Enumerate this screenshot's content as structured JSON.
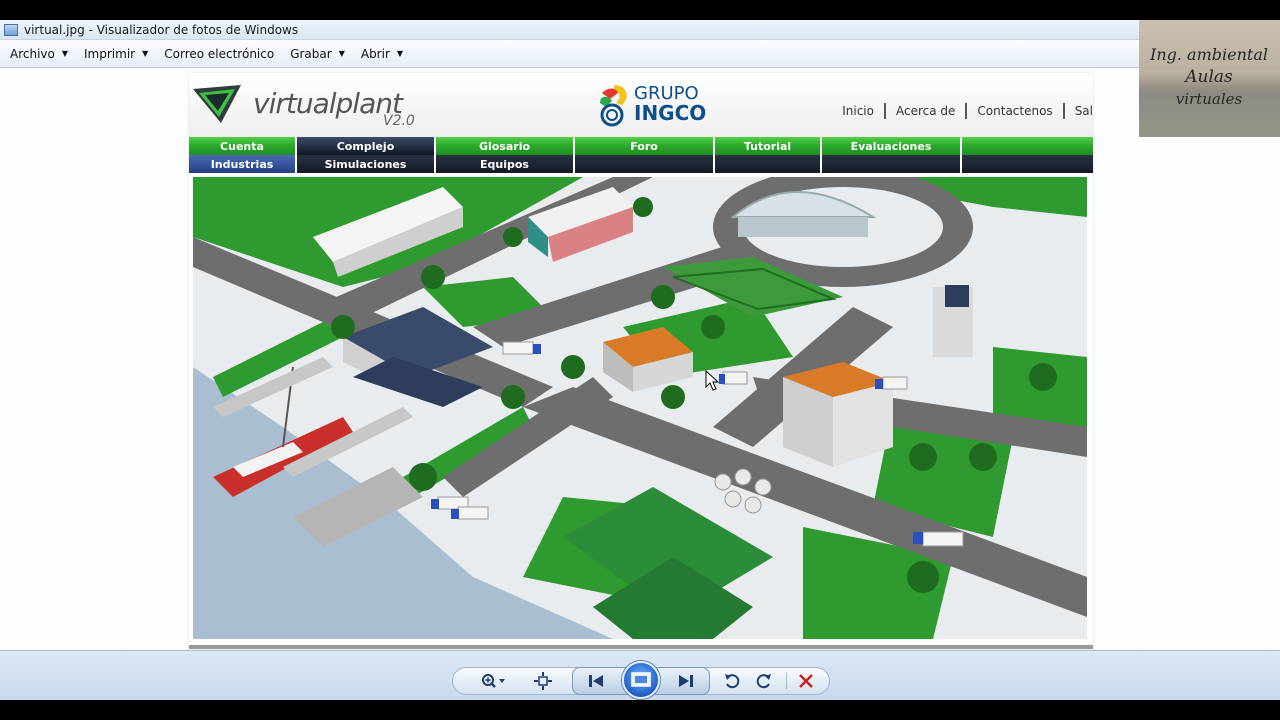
{
  "window": {
    "title": "virtual.jpg - Visualizador de fotos de Windows"
  },
  "menu": [
    {
      "label": "Archivo",
      "has_caret": true
    },
    {
      "label": "Imprimir",
      "has_caret": true
    },
    {
      "label": "Correo electrónico",
      "has_caret": false
    },
    {
      "label": "Grabar",
      "has_caret": true
    },
    {
      "label": "Abrir",
      "has_caret": true
    }
  ],
  "site": {
    "logo_left": {
      "wordmark": "virtualplant",
      "version": "V2.0"
    },
    "logo_center": {
      "grupo": "GRUPO",
      "ingco": "INGCO"
    },
    "top_links": [
      "Inicio",
      "Acerca de",
      "Contactenos",
      "Sal"
    ],
    "nav_top": [
      "Cuenta",
      "Complejo",
      "Glosario",
      "Foro",
      "Tutorial",
      "Evaluaciones",
      ""
    ],
    "nav_bottom": [
      "Industrias",
      "Simulaciones",
      "Equipos",
      "",
      "",
      "",
      ""
    ]
  },
  "watermark": {
    "line1": "Ing. ambiental",
    "line2": "Aulas",
    "line3": "virtuales"
  },
  "toolbar": {
    "icons": [
      "zoom-icon",
      "fit-to-window-icon",
      "previous-icon",
      "slideshow-icon",
      "next-icon",
      "rotate-left-icon",
      "rotate-right-icon",
      "delete-icon"
    ]
  },
  "colors": {
    "nav_green": "#2aa82b",
    "nav_dark": "#141a26",
    "nav_active_blue": "#233f83",
    "grass": "#2f9a2f",
    "road": "#6e6e6e",
    "water": "#a9bfd1"
  }
}
